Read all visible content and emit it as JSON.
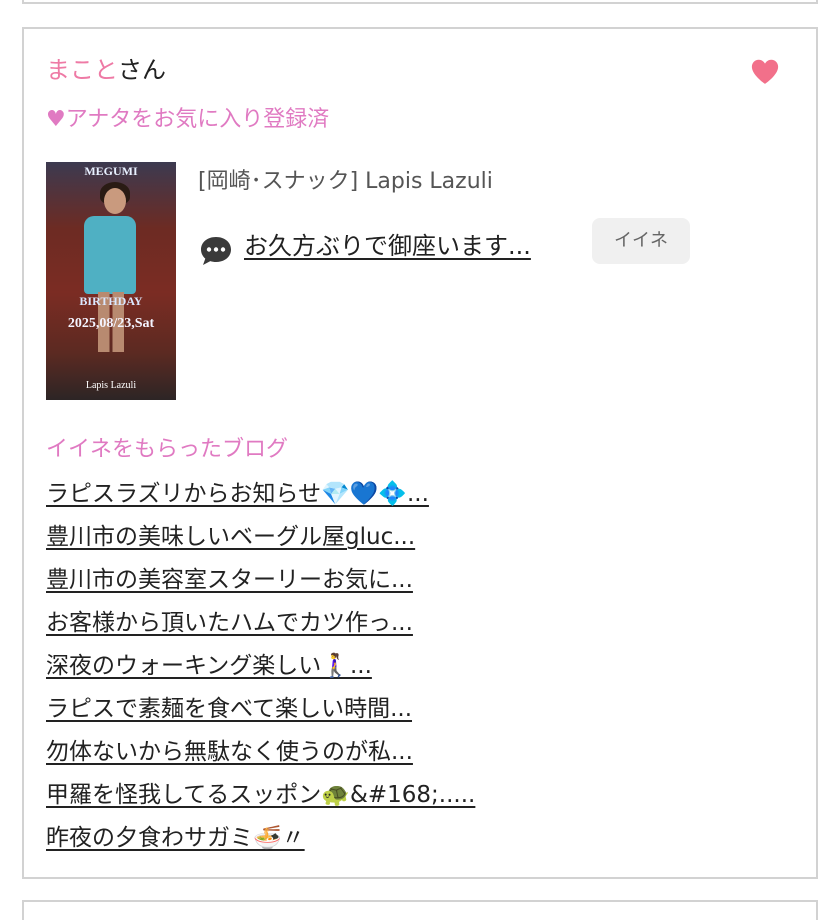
{
  "user": {
    "name": "まこと",
    "suffix": "さん",
    "favorite_status": "♥アナタをお気に入り登録済"
  },
  "post": {
    "thumbnail": {
      "title_text": "MEGUMI",
      "birthday_text": "BIRTHDAY",
      "date_text": "2025,08/23,Sat",
      "shop_text": "Lapis Lazuli"
    },
    "shop_label": "[岡崎･スナック]  Lapis Lazuli",
    "title": "お久方ぶりで御座います...",
    "iine_label": "イイネ"
  },
  "liked_blogs": {
    "heading": "イイネをもらったブログ",
    "items": [
      "ラピスラズリからお知らせ💎💙💠...",
      "豊川市の美味しいベーグル屋gluc...",
      "豊川市の美容室スターリーお気に...",
      "お客様から頂いたハムでカツ作っ...",
      "深夜のウォーキング楽しい🚶‍♀️...",
      "ラピスで素麺を食べて楽しい時間...",
      "勿体ないから無駄なく使うのが私...",
      "甲羅を怪我してるスッポン🐢&#168;.....",
      "昨夜の夕食わサガミ🍜〃"
    ]
  },
  "colors": {
    "accent_pink": "#ee7aa5",
    "heading_pink": "#e07ac2",
    "heart": "#f2708a",
    "border": "#d2d2d2"
  },
  "icons": [
    "heart-icon",
    "speech-bubble-icon"
  ]
}
